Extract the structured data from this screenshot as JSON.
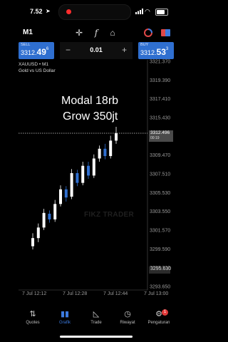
{
  "status": {
    "time": "7.52"
  },
  "toolbar": {
    "timeframe": "M1"
  },
  "trade": {
    "sell_label": "SELL",
    "sell_price_prefix": "3312.",
    "sell_price_big": "49",
    "sell_price_sup": "6",
    "lot": "0.01",
    "buy_label": "BUY",
    "buy_price_prefix": "3312.",
    "buy_price_big": "53",
    "buy_price_sup": "3"
  },
  "symbol": {
    "line1": "XAUUSD • M1",
    "line2": "Gold vs US Dollar"
  },
  "overlay": {
    "line1": "Modal 18rb",
    "line2": "Grow 350jt",
    "watermark": "FIKZ TRADER"
  },
  "price_axis": {
    "labels": [
      "3321.370",
      "3319.390",
      "3317.410",
      "3315.430",
      "3313.450",
      "3309.470",
      "3307.510",
      "3305.530",
      "3303.550",
      "3301.570",
      "3299.590",
      "3297.610",
      "3293.650"
    ],
    "current_price": "3312.496",
    "current_countdown": "00:19",
    "low_tag": "3295.630"
  },
  "time_axis": {
    "labels": [
      "7 Jul 12:12",
      "7 Jul 12:28",
      "7 Jul 12:44",
      "7 Jul 13:00"
    ]
  },
  "colors": {
    "up": "#ffffff",
    "down": "#2f6fd0",
    "accent": "#3c7be0"
  },
  "nav": {
    "items": [
      {
        "label": "Quotes",
        "icon": "quotes-icon"
      },
      {
        "label": "Grafik",
        "icon": "chart-icon"
      },
      {
        "label": "Trade",
        "icon": "trade-icon"
      },
      {
        "label": "Riwayat",
        "icon": "history-icon"
      },
      {
        "label": "Pengaturan",
        "icon": "settings-icon"
      }
    ],
    "settings_badge": "1"
  },
  "chart_data": {
    "type": "candlestick",
    "price_range": [
      3293.65,
      3321.37
    ],
    "candles": [
      {
        "o": 3298.6,
        "c": 3299.6,
        "h": 3300.2,
        "l": 3298.2
      },
      {
        "o": 3299.6,
        "c": 3300.9,
        "h": 3301.4,
        "l": 3299.1
      },
      {
        "o": 3300.9,
        "c": 3302.7,
        "h": 3303.2,
        "l": 3300.6
      },
      {
        "o": 3302.6,
        "c": 3301.9,
        "h": 3303.0,
        "l": 3301.5
      },
      {
        "o": 3301.9,
        "c": 3303.8,
        "h": 3304.3,
        "l": 3301.6
      },
      {
        "o": 3303.8,
        "c": 3305.6,
        "h": 3306.1,
        "l": 3303.5
      },
      {
        "o": 3305.6,
        "c": 3304.6,
        "h": 3306.0,
        "l": 3304.1
      },
      {
        "o": 3304.7,
        "c": 3307.6,
        "h": 3308.1,
        "l": 3304.4
      },
      {
        "o": 3307.6,
        "c": 3306.4,
        "h": 3308.0,
        "l": 3306.0
      },
      {
        "o": 3306.4,
        "c": 3308.5,
        "h": 3309.0,
        "l": 3306.1
      },
      {
        "o": 3308.5,
        "c": 3307.3,
        "h": 3309.0,
        "l": 3306.9
      },
      {
        "o": 3307.3,
        "c": 3309.4,
        "h": 3309.9,
        "l": 3307.0
      },
      {
        "o": 3309.4,
        "c": 3310.6,
        "h": 3311.0,
        "l": 3309.0
      },
      {
        "o": 3310.6,
        "c": 3309.7,
        "h": 3311.2,
        "l": 3309.3
      },
      {
        "o": 3309.7,
        "c": 3311.6,
        "h": 3312.2,
        "l": 3309.4
      },
      {
        "o": 3311.6,
        "c": 3312.5,
        "h": 3313.3,
        "l": 3311.2
      }
    ]
  }
}
